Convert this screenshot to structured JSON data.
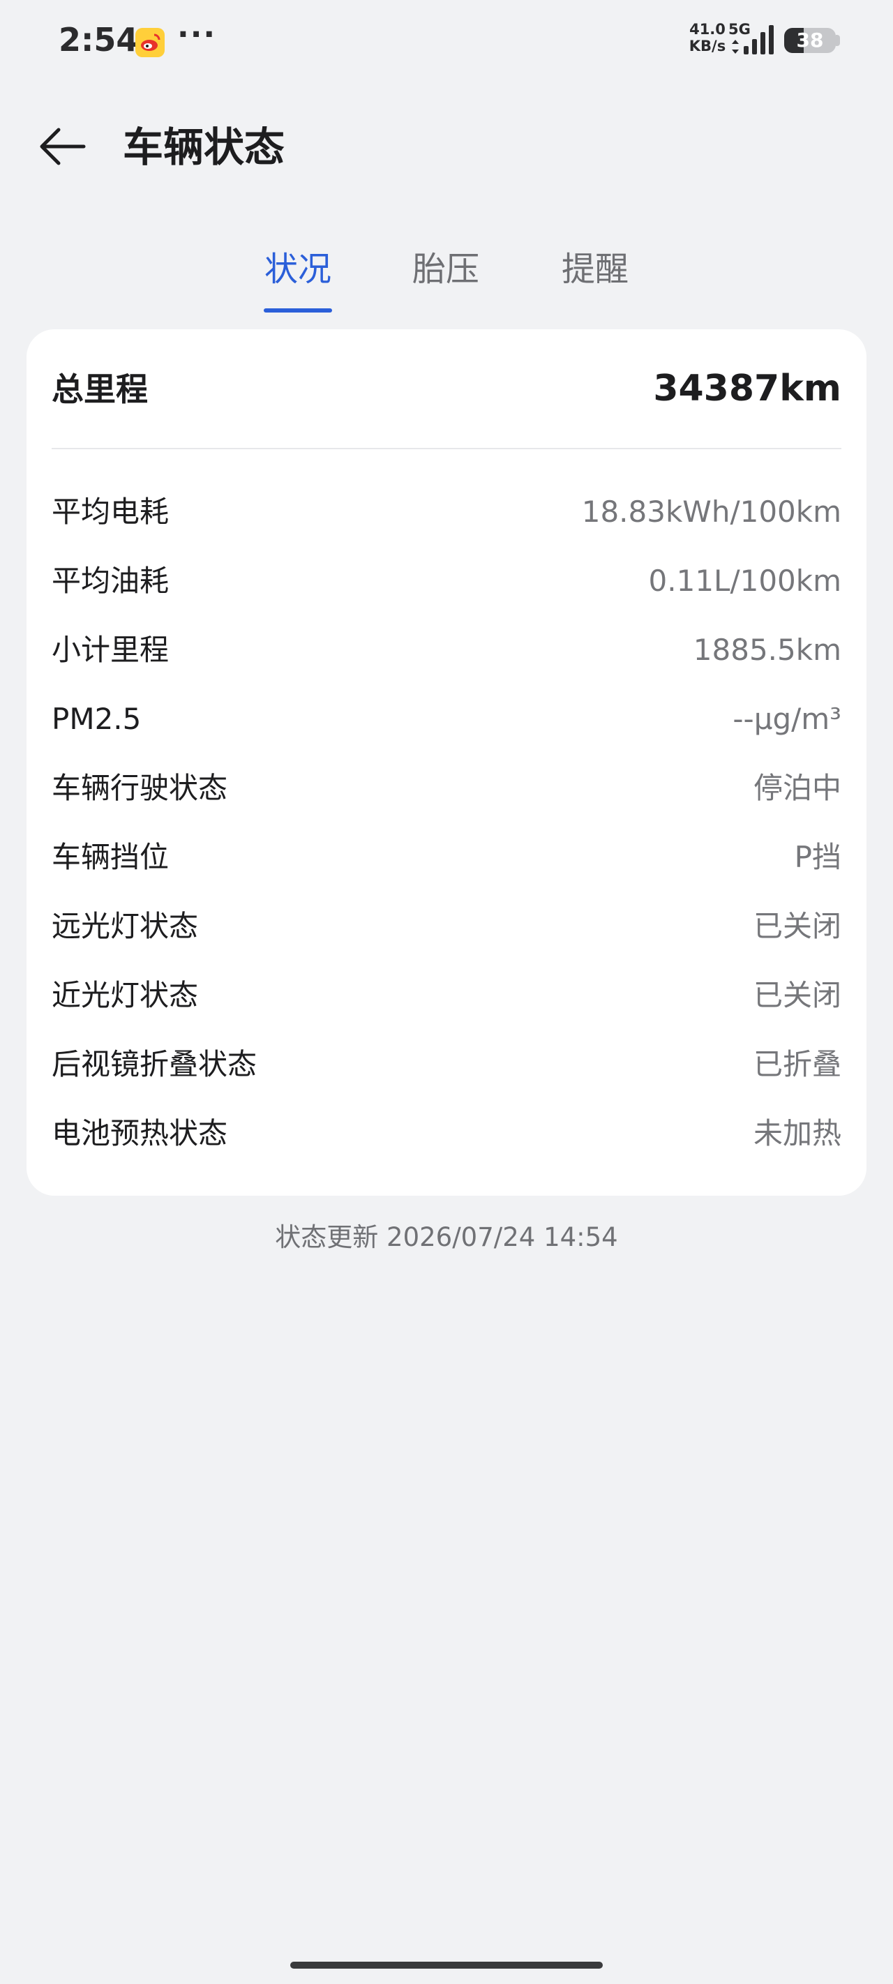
{
  "status_bar": {
    "time": "2:54",
    "notification_icon": "weibo-icon",
    "more_indicator": "···",
    "net_speed_value": "41.0",
    "net_speed_unit": "KB/s",
    "network_type": "5G",
    "battery_level": "38",
    "battery_fraction": 0.38,
    "icons": [
      "weibo-icon",
      "signal-icon",
      "battery-icon"
    ]
  },
  "header": {
    "back_icon": "arrow-left-icon",
    "title": "车辆状态"
  },
  "tabs": [
    {
      "label": "状况",
      "active": true
    },
    {
      "label": "胎压",
      "active": false
    },
    {
      "label": "提醒",
      "active": false
    }
  ],
  "summary": {
    "total_mileage_label": "总里程",
    "total_mileage_value": "34387km"
  },
  "rows": [
    {
      "label": "平均电耗",
      "value": "18.83kWh/100km"
    },
    {
      "label": "平均油耗",
      "value": "0.11L/100km"
    },
    {
      "label": "小计里程",
      "value": "1885.5km"
    },
    {
      "label": "PM2.5",
      "value": "--μg/m³"
    },
    {
      "label": "车辆行驶状态",
      "value": "停泊中"
    },
    {
      "label": "车辆挡位",
      "value": "P挡"
    },
    {
      "label": "远光灯状态",
      "value": "已关闭"
    },
    {
      "label": "近光灯状态",
      "value": "已关闭"
    },
    {
      "label": "后视镜折叠状态",
      "value": "已折叠"
    },
    {
      "label": "电池预热状态",
      "value": "未加热"
    }
  ],
  "footer": {
    "update_text": "状态更新 2026/07/24 14:54"
  },
  "colors": {
    "accent": "#2b5fd9",
    "background": "#f1f2f4",
    "card": "#ffffff",
    "secondary_text": "#75767a"
  }
}
